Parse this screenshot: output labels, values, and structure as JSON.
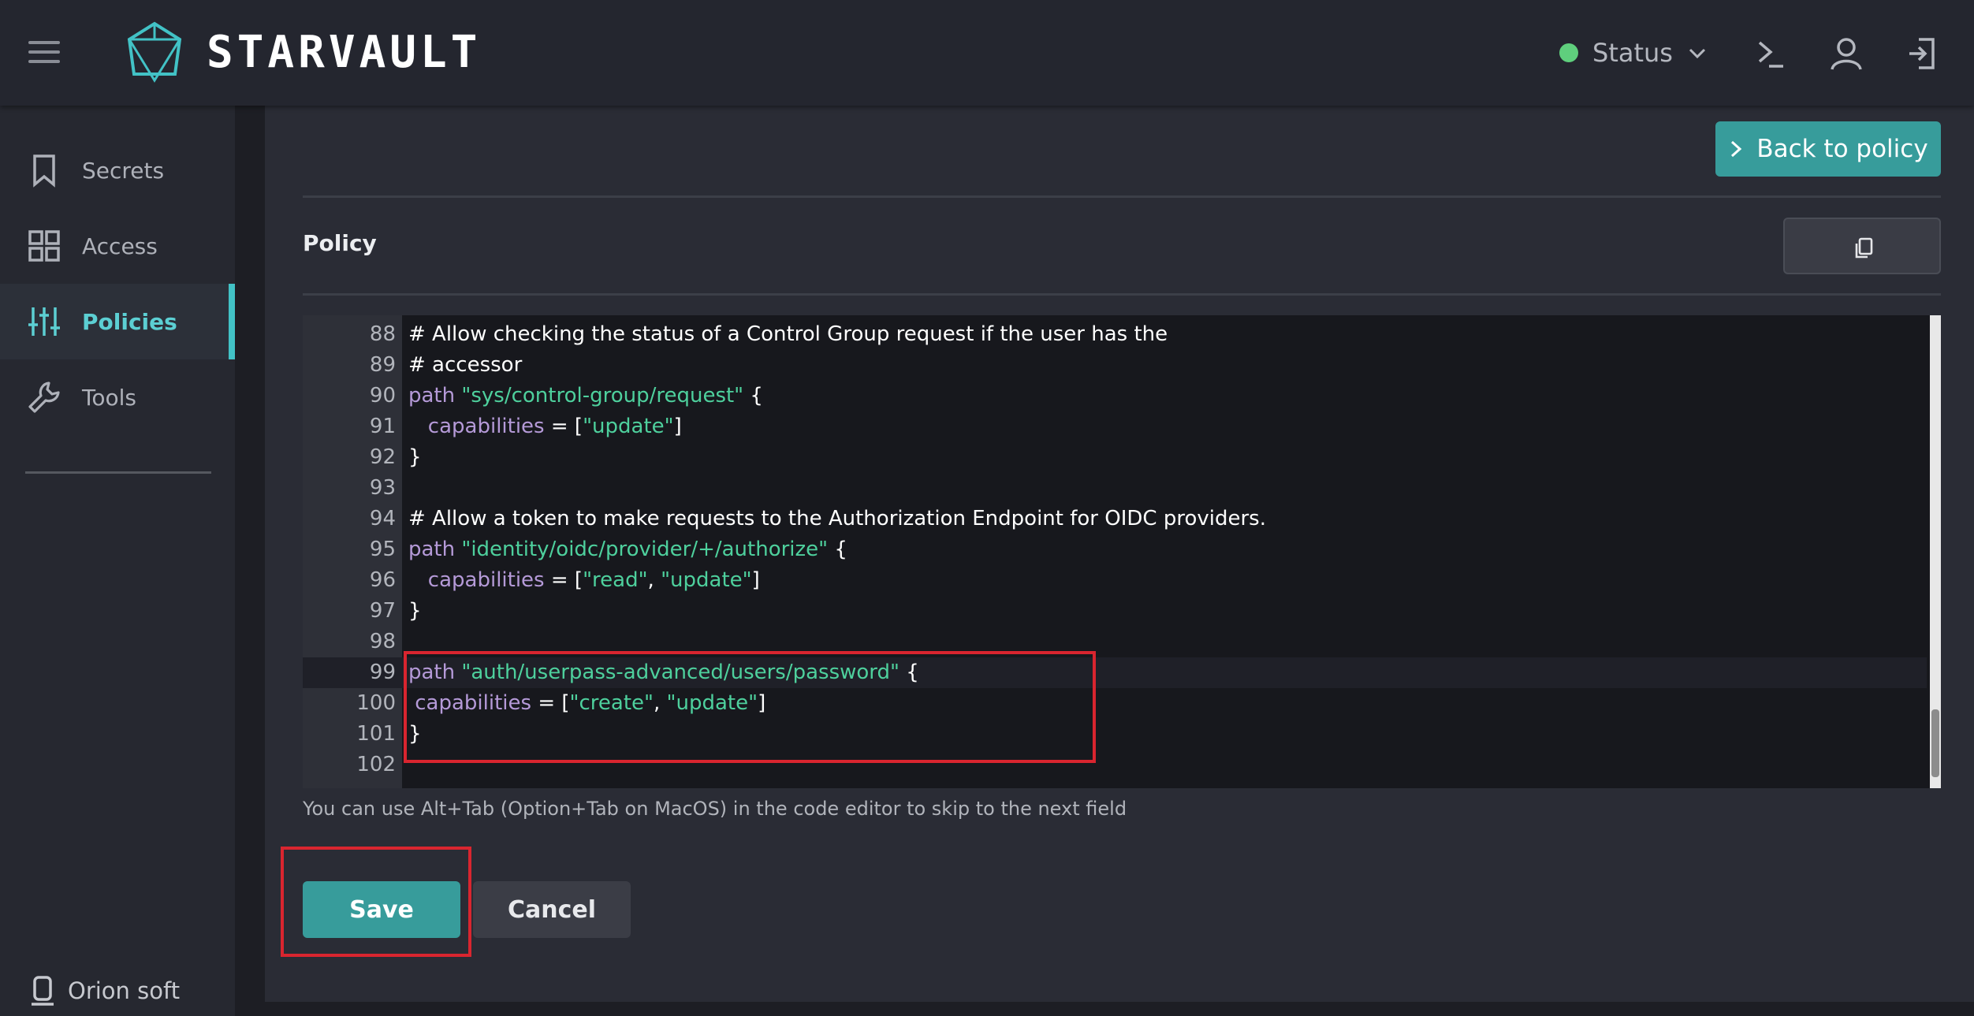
{
  "app": {
    "brand": "STARVAULT",
    "status_label": "Status",
    "status_color": "#5fcf7d",
    "accent_color": "#379c9b",
    "icons": [
      "menu-icon",
      "logo-icon",
      "chevron-down-icon",
      "terminal-icon",
      "user-icon",
      "logout-icon"
    ]
  },
  "sidebar": {
    "items": [
      {
        "label": "Secrets",
        "icon": "bookmark-icon",
        "active": false
      },
      {
        "label": "Access",
        "icon": "grid-icon",
        "active": false
      },
      {
        "label": "Policies",
        "icon": "sliders-icon",
        "active": true
      },
      {
        "label": "Tools",
        "icon": "wrench-icon",
        "active": false
      }
    ],
    "org_label": "Orion soft",
    "org_icon": "org-icon"
  },
  "main": {
    "back_button_label": "Back to policy",
    "policy_label": "Policy",
    "copy_icon": "copy-icon",
    "hint": "You can use Alt+Tab (Option+Tab on MacOS) in the code editor to skip to the next field",
    "save_label": "Save",
    "cancel_label": "Cancel"
  },
  "editor": {
    "current_line": 99,
    "lines": [
      {
        "n": "88",
        "parts": [
          {
            "t": "# Allow checking the status of a Control Group request if the user has the",
            "c": "plain"
          }
        ]
      },
      {
        "n": "89",
        "parts": [
          {
            "t": "# accessor",
            "c": "plain"
          }
        ]
      },
      {
        "n": "90",
        "parts": [
          {
            "t": "path",
            "c": "kw"
          },
          {
            "t": " ",
            "c": "plain"
          },
          {
            "t": "\"sys/control-group/request\"",
            "c": "str"
          },
          {
            "t": " {",
            "c": "plain"
          }
        ]
      },
      {
        "n": "91",
        "parts": [
          {
            "t": "   ",
            "c": "plain"
          },
          {
            "t": "capabilities",
            "c": "kw"
          },
          {
            "t": " = [",
            "c": "plain"
          },
          {
            "t": "\"update\"",
            "c": "str"
          },
          {
            "t": "]",
            "c": "plain"
          }
        ]
      },
      {
        "n": "92",
        "parts": [
          {
            "t": "}",
            "c": "plain"
          }
        ]
      },
      {
        "n": "93",
        "parts": []
      },
      {
        "n": "94",
        "parts": [
          {
            "t": "# Allow a token to make requests to the Authorization Endpoint for OIDC providers.",
            "c": "plain"
          }
        ]
      },
      {
        "n": "95",
        "parts": [
          {
            "t": "path",
            "c": "kw"
          },
          {
            "t": " ",
            "c": "plain"
          },
          {
            "t": "\"identity/oidc/provider/+/authorize\"",
            "c": "str"
          },
          {
            "t": " {",
            "c": "plain"
          }
        ]
      },
      {
        "n": "96",
        "parts": [
          {
            "t": "   ",
            "c": "plain"
          },
          {
            "t": "capabilities",
            "c": "kw"
          },
          {
            "t": " = [",
            "c": "plain"
          },
          {
            "t": "\"read\"",
            "c": "str"
          },
          {
            "t": ", ",
            "c": "plain"
          },
          {
            "t": "\"update\"",
            "c": "str"
          },
          {
            "t": "]",
            "c": "plain"
          }
        ]
      },
      {
        "n": "97",
        "parts": [
          {
            "t": "}",
            "c": "plain"
          }
        ]
      },
      {
        "n": "98",
        "parts": []
      },
      {
        "n": "99",
        "parts": [
          {
            "t": "path",
            "c": "kw"
          },
          {
            "t": " ",
            "c": "plain"
          },
          {
            "t": "\"auth/userpass-advanced/users/password\"",
            "c": "str"
          },
          {
            "t": " {",
            "c": "plain"
          }
        ]
      },
      {
        "n": "100",
        "parts": [
          {
            "t": " ",
            "c": "plain"
          },
          {
            "t": "capabilities",
            "c": "kw"
          },
          {
            "t": " = [",
            "c": "plain"
          },
          {
            "t": "\"create\"",
            "c": "str"
          },
          {
            "t": ", ",
            "c": "plain"
          },
          {
            "t": "\"update\"",
            "c": "str"
          },
          {
            "t": "]",
            "c": "plain"
          }
        ]
      },
      {
        "n": "101",
        "parts": [
          {
            "t": "}",
            "c": "plain"
          }
        ]
      },
      {
        "n": "102",
        "parts": []
      }
    ]
  }
}
